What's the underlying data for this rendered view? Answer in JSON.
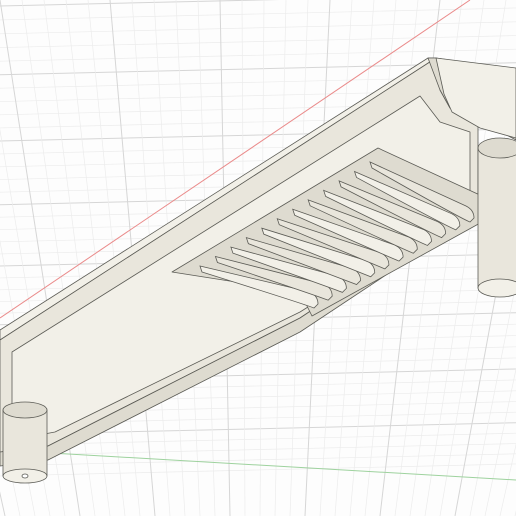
{
  "viewport": {
    "background_color": "#fdfdfd",
    "grid": {
      "visible": true,
      "minor_line_color": "#ececec",
      "major_line_color": "#d6d6d6",
      "x_axis_color": "#ea8a8a",
      "y_axis_color": "#9ed29e"
    }
  },
  "model": {
    "type": "bracket-with-vent-slots",
    "body_color": "#e9e6dc",
    "edge_color": "#5b5b55",
    "shade_light": "#f2f0e8",
    "shade_mid": "#dedbd0",
    "shade_dark": "#c8c5b9",
    "vent_slot_count": 12,
    "support_post_count": 2
  }
}
